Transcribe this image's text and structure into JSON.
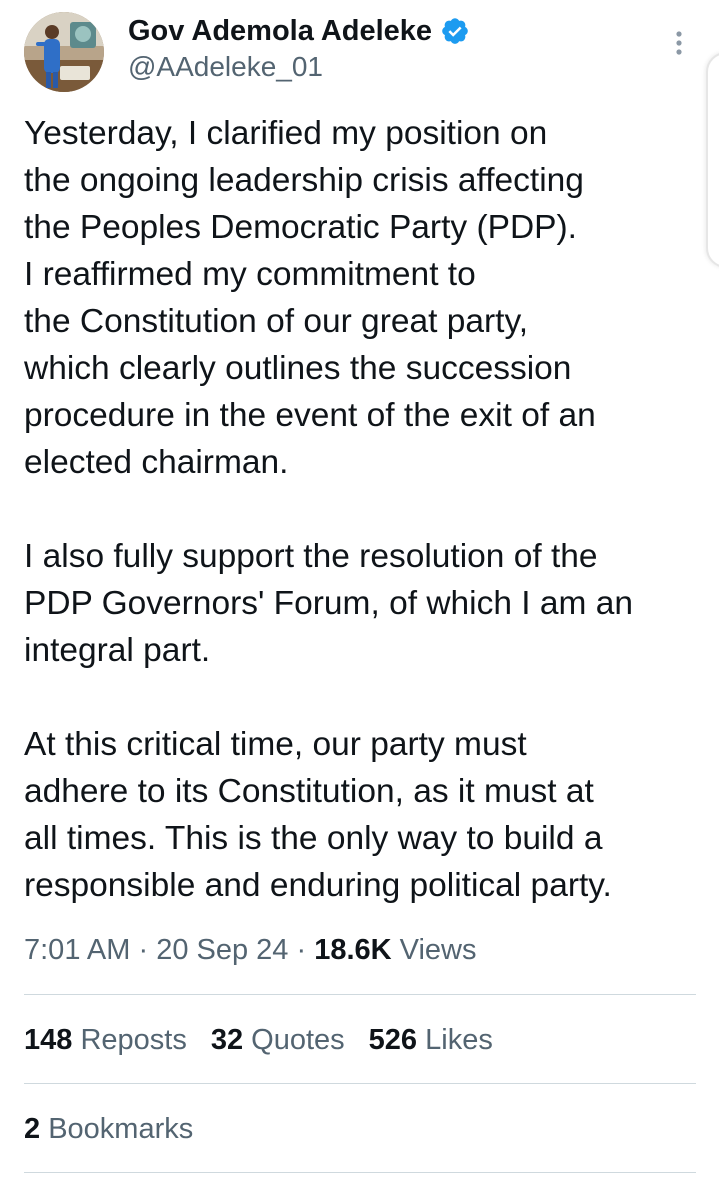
{
  "author": {
    "display_name": "Gov Ademola Adeleke",
    "handle": "@AAdeleke_01",
    "verified": true,
    "verified_color": "#1d9bf0",
    "avatar_icon": "profile-photo"
  },
  "more_icon": "more-vertical-icon",
  "tweet": {
    "paragraphs": [
      [
        "Yesterday, I clarified my position on",
        "the ongoing leadership crisis affecting",
        "the Peoples Democratic Party (PDP).",
        "I reaffirmed my commitment to",
        "the Constitution of our great party,",
        "which clearly outlines the succession",
        "procedure in the event of the exit of an",
        "elected chairman."
      ],
      [
        "I also fully support the resolution of the",
        "PDP Governors' Forum, of which I am an",
        "integral part."
      ],
      [
        "At this critical time, our party must",
        "adhere to its Constitution, as it must at",
        "all times. This is the only way to build a",
        "responsible and enduring political party."
      ]
    ]
  },
  "meta": {
    "time": "7:01 AM",
    "separator": " · ",
    "date": "20 Sep 24",
    "views_count": "18.6K",
    "views_label": " Views"
  },
  "stats": {
    "reposts_count": "148",
    "reposts_label": " Reposts",
    "quotes_count": "32",
    "quotes_label": " Quotes",
    "likes_count": "526",
    "likes_label": " Likes",
    "bookmarks_count": "2",
    "bookmarks_label": " Bookmarks"
  }
}
